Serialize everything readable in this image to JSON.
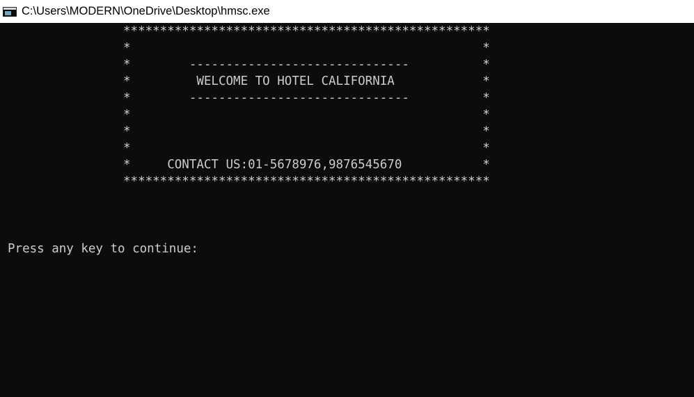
{
  "window": {
    "title": "C:\\Users\\MODERN\\OneDrive\\Desktop\\hmsc.exe",
    "icon": "console-app-icon"
  },
  "console": {
    "lines": [
      "**************************************************",
      "*                                                *",
      "*        ------------------------------          *",
      "*         WELCOME TO HOTEL CALIFORNIA            *",
      "*        ------------------------------          *",
      "*                                                *",
      "*                                                *",
      "*                                                *",
      "*     CONTACT US:01-5678976,9876545670           *",
      "**************************************************"
    ],
    "prompt": "Press any key to continue:"
  },
  "colors": {
    "background": "#0c0c0c",
    "text": "#cccccc",
    "titlebar": "#ffffff"
  }
}
